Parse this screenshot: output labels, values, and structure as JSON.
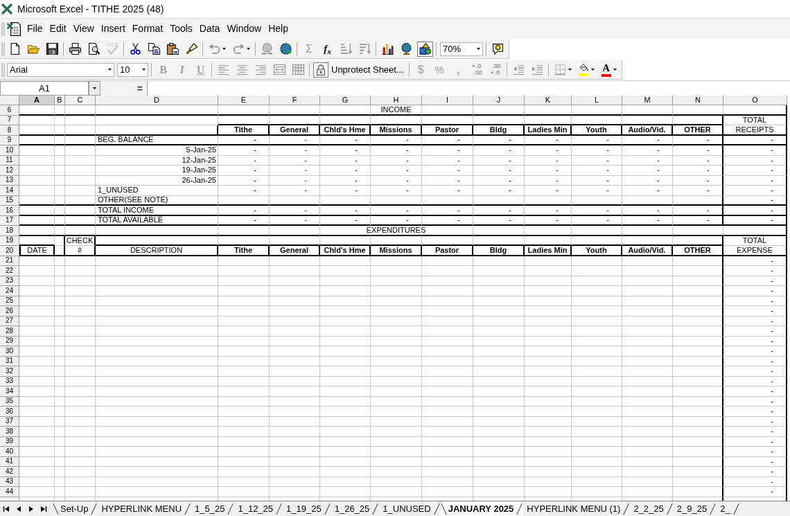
{
  "window": {
    "title": "Microsoft Excel - TITHE 2025 (48)"
  },
  "menu": [
    {
      "label": "File"
    },
    {
      "label": "Edit"
    },
    {
      "label": "View"
    },
    {
      "label": "Insert"
    },
    {
      "label": "Format"
    },
    {
      "label": "Tools"
    },
    {
      "label": "Data"
    },
    {
      "label": "Window"
    },
    {
      "label": "Help"
    }
  ],
  "standard_toolbar": {
    "groups": [
      [
        {
          "kind": "new",
          "disabled": false,
          "pressed": false
        },
        {
          "kind": "open",
          "disabled": false,
          "pressed": false
        },
        {
          "kind": "save",
          "disabled": false,
          "pressed": false
        }
      ],
      [
        {
          "kind": "print",
          "disabled": false,
          "pressed": false
        },
        {
          "kind": "preview",
          "disabled": false,
          "pressed": false
        },
        {
          "kind": "spelling",
          "disabled": true,
          "pressed": false
        }
      ],
      [
        {
          "kind": "cut",
          "disabled": false,
          "pressed": false
        },
        {
          "kind": "copy",
          "disabled": false,
          "pressed": false
        },
        {
          "kind": "paste",
          "disabled": false,
          "pressed": false
        },
        {
          "kind": "painter",
          "disabled": false,
          "pressed": false
        }
      ],
      [
        {
          "kind": "undo",
          "disabled": true,
          "pressed": false,
          "dropdown": true
        },
        {
          "kind": "redo",
          "disabled": true,
          "pressed": false,
          "dropdown": true
        }
      ],
      [
        {
          "kind": "hyperlink",
          "disabled": true,
          "pressed": false
        },
        {
          "kind": "web",
          "disabled": false,
          "pressed": false
        }
      ],
      [
        {
          "kind": "autosum",
          "text": "Σ",
          "disabled": true,
          "pressed": false
        },
        {
          "kind": "function",
          "text": "f$_{x}$",
          "disabled": false,
          "pressed": false
        },
        {
          "kind": "sort_asc",
          "disabled": true,
          "pressed": false
        },
        {
          "kind": "sort_desc",
          "disabled": true,
          "pressed": false
        }
      ],
      [
        {
          "kind": "chart",
          "disabled": false,
          "pressed": false
        },
        {
          "kind": "map",
          "disabled": false,
          "pressed": false
        },
        {
          "kind": "drawing",
          "disabled": false,
          "pressed": true
        }
      ],
      [
        {
          "kind": "zoom",
          "value": "70%"
        }
      ],
      [
        {
          "kind": "assistant",
          "disabled": false,
          "pressed": false
        }
      ]
    ]
  },
  "formatting_toolbar": {
    "groups": [
      [
        {
          "kind": "font",
          "value": "Arial"
        },
        {
          "kind": "size",
          "value": "10"
        }
      ],
      [
        {
          "kind": "bold",
          "text": "B",
          "disabled": true,
          "pressed": false
        },
        {
          "kind": "italic",
          "text": "I",
          "disabled": true,
          "pressed": false
        },
        {
          "kind": "underline",
          "text": "U",
          "disabled": true,
          "pressed": false
        }
      ],
      [
        {
          "kind": "align_left",
          "disabled": true,
          "pressed": false
        },
        {
          "kind": "align_center",
          "disabled": true,
          "pressed": false
        },
        {
          "kind": "align_right",
          "disabled": true,
          "pressed": false
        },
        {
          "kind": "merge",
          "disabled": true,
          "pressed": false
        },
        {
          "kind": "grid",
          "disabled": true,
          "pressed": false
        }
      ],
      [
        {
          "kind": "protect",
          "text": "Unprotect Sheet...",
          "disabled": false,
          "pressed": true
        }
      ],
      [
        {
          "kind": "currency",
          "text": "$",
          "disabled": true,
          "pressed": false
        },
        {
          "kind": "percent",
          "text": "%",
          "disabled": true,
          "pressed": false
        },
        {
          "kind": "comma",
          "text": ",",
          "disabled": true,
          "pressed": false
        },
        {
          "kind": "add_decimal",
          "disabled": true,
          "pressed": false
        },
        {
          "kind": "remove_decimal",
          "disabled": true,
          "pressed": false
        }
      ],
      [
        {
          "kind": "outdent",
          "disabled": true,
          "pressed": false
        },
        {
          "kind": "indent",
          "disabled": true,
          "pressed": false
        }
      ],
      [
        {
          "kind": "borders",
          "disabled": true,
          "pressed": false,
          "dropdown": true
        },
        {
          "kind": "fill",
          "color": "#ffff00",
          "disabled": false,
          "pressed": false,
          "dropdown": true
        },
        {
          "kind": "font_color",
          "text": "A",
          "color": "#ff0000",
          "disabled": false,
          "pressed": false,
          "dropdown": true
        }
      ]
    ]
  },
  "formula_bar": {
    "name_box": "A1",
    "edit_button": "="
  },
  "sheet": {
    "columns": [
      {
        "label": "A",
        "selected": true
      },
      {
        "label": "B",
        "selected": false
      },
      {
        "label": "C",
        "selected": false
      },
      {
        "label": "D",
        "selected": false
      },
      {
        "label": "E",
        "selected": false
      },
      {
        "label": "F",
        "selected": false
      },
      {
        "label": "G",
        "selected": false
      },
      {
        "label": "H",
        "selected": false
      },
      {
        "label": "I",
        "selected": false
      },
      {
        "label": "J",
        "selected": false
      },
      {
        "label": "K",
        "selected": false
      },
      {
        "label": "L",
        "selected": false
      },
      {
        "label": "M",
        "selected": false
      },
      {
        "label": "N",
        "selected": false
      },
      {
        "label": "O",
        "selected": false
      }
    ],
    "rows": [
      {
        "number": "6",
        "kind": "title",
        "text": "INCOME"
      },
      {
        "number": "7",
        "kind": "income_top",
        "total": "TOTAL"
      },
      {
        "number": "8",
        "kind": "income_headings",
        "headings": [
          "Tithe",
          "General",
          "Chld's Hme",
          "Missions",
          "Pastor",
          "Bldg",
          "Ladies Min",
          "Youth",
          "Audio/Vid.",
          "OTHER"
        ],
        "total": "RECEIPTS"
      },
      {
        "number": "9",
        "kind": "balance",
        "label": "BEG. BALANCE",
        "values": [
          "-",
          "-",
          "-",
          "-",
          "-",
          "-",
          "-",
          "-",
          "-",
          "-"
        ],
        "total": "-"
      },
      {
        "number": "10",
        "kind": "week",
        "label": "5-Jan-25",
        "values": [
          "-",
          "-",
          "-",
          "-",
          "-",
          "-",
          "-",
          "-",
          "-",
          "-"
        ],
        "total": "-"
      },
      {
        "number": "11",
        "kind": "week",
        "label": "12-Jan-25",
        "values": [
          "-",
          "-",
          "-",
          "-",
          "-",
          "-",
          "-",
          "-",
          "-",
          "-"
        ],
        "total": "-"
      },
      {
        "number": "12",
        "kind": "week",
        "label": "19-Jan-25",
        "values": [
          "-",
          "-",
          "-",
          "-",
          "-",
          "-",
          "-",
          "-",
          "-",
          "-"
        ],
        "total": "-"
      },
      {
        "number": "13",
        "kind": "week",
        "label": "26-Jan-25",
        "values": [
          "-",
          "-",
          "-",
          "-",
          "-",
          "-",
          "-",
          "-",
          "-",
          "-"
        ],
        "total": "-"
      },
      {
        "number": "14",
        "kind": "item",
        "label": "1_UNUSED",
        "values": [
          "-",
          "-",
          "-",
          "-",
          "-",
          "-",
          "-",
          "-",
          "-",
          "-"
        ],
        "total": "-"
      },
      {
        "number": "15",
        "kind": "note",
        "label": "OTHER(SEE NOTE)",
        "total": "-"
      },
      {
        "number": "16",
        "kind": "sum",
        "label": "TOTAL INCOME",
        "values": [
          "-",
          "-",
          "-",
          "-",
          "-",
          "-",
          "-",
          "-",
          "-",
          "-"
        ],
        "total": "-"
      },
      {
        "number": "17",
        "kind": "sum",
        "label": "TOTAL AVAILABLE",
        "values": [
          "-",
          "-",
          "-",
          "-",
          "-",
          "-",
          "-",
          "-",
          "-",
          "-"
        ],
        "total": "-"
      },
      {
        "number": "18",
        "kind": "title",
        "text": "EXPENDITURES"
      },
      {
        "number": "19",
        "kind": "expense_top",
        "check": "CHECK",
        "total": "TOTAL"
      },
      {
        "number": "20",
        "kind": "expense_headings",
        "date": "DATE",
        "check": "#",
        "description": "DESCRIPTION",
        "headings": [
          "Tithe",
          "General",
          "Chld's Hme",
          "Missions",
          "Pastor",
          "Bldg",
          "Ladies Min",
          "Youth",
          "Audio/Vid.",
          "OTHER"
        ],
        "total": "EXPENSE"
      },
      {
        "number": "21",
        "kind": "entry",
        "total": "-"
      },
      {
        "number": "22",
        "kind": "entry",
        "total": "-"
      },
      {
        "number": "23",
        "kind": "entry",
        "total": "-"
      },
      {
        "number": "24",
        "kind": "entry",
        "total": "-"
      },
      {
        "number": "25",
        "kind": "entry",
        "total": "-"
      },
      {
        "number": "26",
        "kind": "entry",
        "total": "-"
      },
      {
        "number": "27",
        "kind": "entry",
        "total": "-"
      },
      {
        "number": "28",
        "kind": "entry",
        "total": "-"
      },
      {
        "number": "29",
        "kind": "entry",
        "total": "-"
      },
      {
        "number": "30",
        "kind": "entry",
        "total": "-"
      },
      {
        "number": "31",
        "kind": "entry",
        "total": "-"
      },
      {
        "number": "32",
        "kind": "entry",
        "total": "-"
      },
      {
        "number": "33",
        "kind": "entry",
        "total": "-"
      },
      {
        "number": "34",
        "kind": "entry",
        "total": "-"
      },
      {
        "number": "35",
        "kind": "entry",
        "total": "-"
      },
      {
        "number": "36",
        "kind": "entry",
        "total": "-"
      },
      {
        "number": "37",
        "kind": "entry",
        "total": "-"
      },
      {
        "number": "38",
        "kind": "entry",
        "total": "-"
      },
      {
        "number": "39",
        "kind": "entry",
        "total": "-"
      },
      {
        "number": "40",
        "kind": "entry",
        "total": "-"
      },
      {
        "number": "41",
        "kind": "entry",
        "total": "-"
      },
      {
        "number": "42",
        "kind": "entry",
        "total": "-"
      },
      {
        "number": "43",
        "kind": "entry",
        "total": "-"
      },
      {
        "number": "44",
        "kind": "entry",
        "total": "-"
      }
    ]
  },
  "sheet_tabs": [
    {
      "label": "Set-Up",
      "selected": false
    },
    {
      "label": "HYPERLINK MENU",
      "selected": false
    },
    {
      "label": "1_5_25",
      "selected": false
    },
    {
      "label": "1_12_25",
      "selected": false
    },
    {
      "label": "1_19_25",
      "selected": false
    },
    {
      "label": "1_26_25",
      "selected": false
    },
    {
      "label": "1_UNUSED",
      "selected": false
    },
    {
      "label": "JANUARY 2025",
      "selected": true
    },
    {
      "label": "HYPERLINK MENU (1)",
      "selected": false
    },
    {
      "label": "2_2_25",
      "selected": false
    },
    {
      "label": "2_9_25",
      "selected": false
    },
    {
      "label": "2_",
      "selected": false
    }
  ]
}
